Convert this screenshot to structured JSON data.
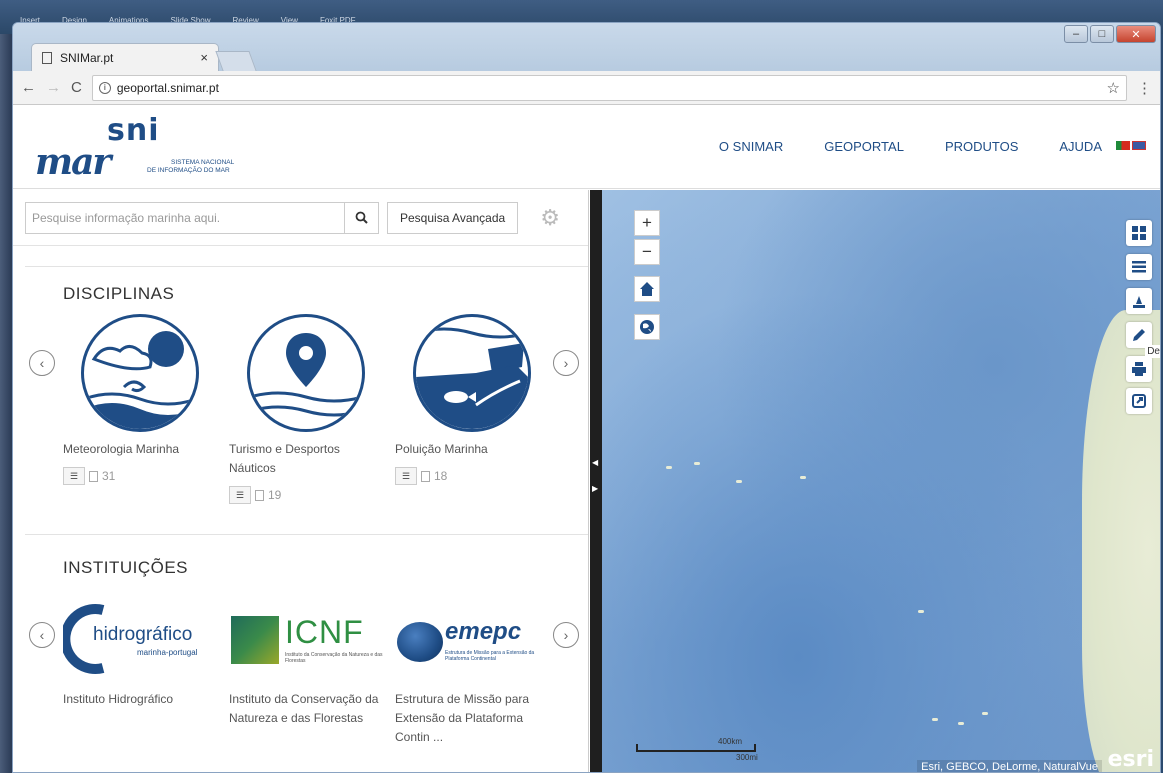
{
  "desktop": {
    "menu": [
      "Insert",
      "Design",
      "Animations",
      "Slide Show",
      "Review",
      "View",
      "Foxit PDF"
    ]
  },
  "browser": {
    "tab_title": "SNIMar.pt",
    "tab_close": "×",
    "url": "geoportal.snimar.pt",
    "nav_back": "←",
    "nav_forward": "→",
    "nav_reload": "C",
    "star": "☆",
    "menu": "⋮"
  },
  "header": {
    "logo_sni": "sni",
    "logo_mar": "mar",
    "logo_tagline_1": "SISTEMA NACIONAL",
    "logo_tagline_2": "DE INFORMAÇÃO DO MAR",
    "nav": [
      "O SNIMAR",
      "GEOPORTAL",
      "PRODUTOS",
      "AJUDA"
    ]
  },
  "search": {
    "placeholder": "Pesquise informação marinha aqui.",
    "advanced_label": "Pesquisa Avançada"
  },
  "disciplinas": {
    "title": "DISCIPLINAS",
    "items": [
      {
        "label": "Meteorologia Marinha",
        "count": "31"
      },
      {
        "label": "Turismo e Desportos Náuticos",
        "count": "19"
      },
      {
        "label": "Poluição Marinha",
        "count": "18"
      }
    ]
  },
  "instituicoes": {
    "title": "INSTITUIÇÕES",
    "items": [
      {
        "label": "Instituto Hidrográfico",
        "logo_text": "hidrográfico",
        "logo_sub": "marinha-portugal"
      },
      {
        "label": "Instituto da Conservação da Natureza e das Florestas",
        "logo_text": "ICNF",
        "logo_sub": "Instituto da Conservação da Natureza e das Florestas"
      },
      {
        "label": "Estrutura de Missão para Extensão da Plataforma Contin ...",
        "logo_text": "emepc",
        "logo_sub": "Estrutura de Missão para a Extensão da Plataforma Continental"
      }
    ]
  },
  "map": {
    "zoom_in": "+",
    "zoom_out": "−",
    "scale_label_1": "400km",
    "scale_label_2": "300mi",
    "attribution": "Esri, GEBCO, DeLorme, NaturalVue",
    "esri_logo": "esri",
    "tooltip_peek": "De"
  }
}
